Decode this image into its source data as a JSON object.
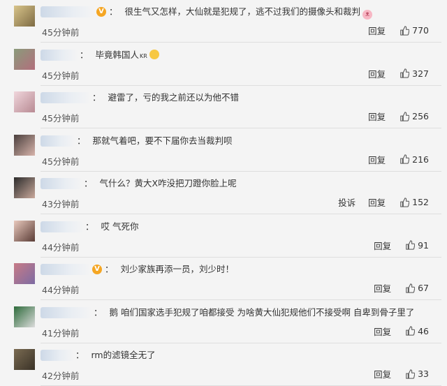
{
  "comments": [
    {
      "name_width": 78,
      "verified": true,
      "text": "很生气又怎样，大仙就是犯规了，逃不过我们的摄像头和裁判",
      "emoji": "pig",
      "time": "45分钟前",
      "actions": [
        "回复"
      ],
      "likes": "770"
    },
    {
      "name_width": 54,
      "verified": false,
      "text": "毕竟韩国人",
      "kr": "KR",
      "emoji": "face",
      "time": "45分钟前",
      "actions": [
        "回复"
      ],
      "likes": "327"
    },
    {
      "name_width": 72,
      "verified": false,
      "text": "避雷了，亏的我之前还以为他不错",
      "time": "45分钟前",
      "actions": [
        "回复"
      ],
      "likes": "256"
    },
    {
      "name_width": 50,
      "verified": false,
      "text": "那就气着吧，要不下届你去当裁判呗",
      "time": "45分钟前",
      "actions": [
        "回复"
      ],
      "likes": "216"
    },
    {
      "name_width": 60,
      "verified": false,
      "text": "气什么？黄大X咋没把刀蹬你脸上呢",
      "time": "43分钟前",
      "actions": [
        "投诉",
        "回复"
      ],
      "likes": "152"
    },
    {
      "name_width": 62,
      "verified": false,
      "text": "哎 气死你",
      "time": "44分钟前",
      "actions": [
        "回复"
      ],
      "likes": "91"
    },
    {
      "name_width": 72,
      "verified": true,
      "text": "刘少家族再添一员，刘少时！",
      "time": "44分钟前",
      "actions": [
        "回复"
      ],
      "likes": "67"
    },
    {
      "name_width": 74,
      "verified": false,
      "text": "鹅 咱们国家选手犯规了咱都接受 为啥黄大仙犯规他们不接受啊 自卑到骨子里了",
      "time": "41分钟前",
      "actions": [
        "回复"
      ],
      "likes": "46"
    },
    {
      "name_width": 48,
      "verified": false,
      "text": "rm的滤镜全无了",
      "time": "42分钟前",
      "actions": [
        "回复"
      ],
      "likes": "33"
    }
  ]
}
